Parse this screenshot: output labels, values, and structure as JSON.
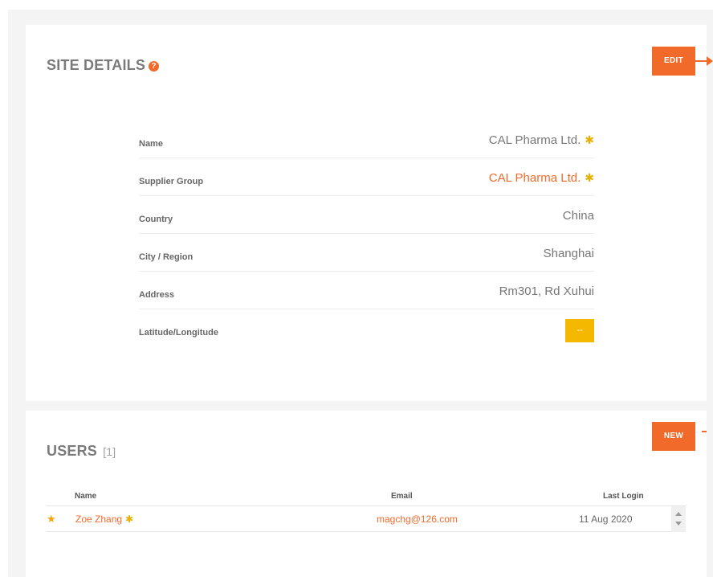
{
  "site_details": {
    "title": "SITE DETAILS",
    "help_icon": "question-circle-icon",
    "edit_label": "EDIT",
    "fields": [
      {
        "label": "Name",
        "value": "CAL Pharma Ltd.",
        "required": "✱"
      },
      {
        "label": "Supplier Group",
        "value": "CAL Pharma Ltd.",
        "required": "✱"
      },
      {
        "label": "Country",
        "value": "China"
      },
      {
        "label": "City / Region",
        "value": "Shanghai"
      },
      {
        "label": "Address",
        "value": "Rm301, Rd Xuhui"
      },
      {
        "label": "Latitude/Longitude",
        "value": "--"
      }
    ]
  },
  "users": {
    "title": "USERS",
    "count": "[1]",
    "new_label": "NEW",
    "columns": {
      "name": "Name",
      "email": "Email",
      "last_login": "Last Login"
    },
    "rows": [
      {
        "name": "Zoe Zhang",
        "required": "✱",
        "email": "magchg@126.com",
        "last_login": "11 Aug 2020",
        "starred": "star-icon"
      }
    ]
  },
  "colors": {
    "accent": "#f26a2a",
    "required": "#e8b000",
    "latlong_button": "#f5b800",
    "background": "#f4f4f4"
  }
}
